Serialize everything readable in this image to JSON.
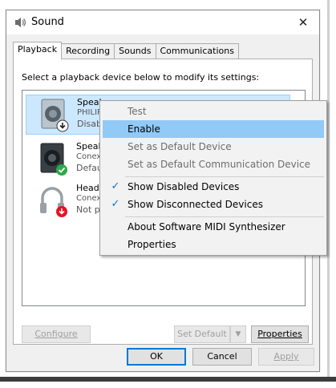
{
  "window": {
    "title": "Sound",
    "icon": "speaker-icon",
    "close_glyph": "✕"
  },
  "tabs": [
    {
      "label": "Playback",
      "active": true
    },
    {
      "label": "Recording"
    },
    {
      "label": "Sounds"
    },
    {
      "label": "Communications"
    }
  ],
  "instruction": "Select a playback device below to modify its settings:",
  "devices": [
    {
      "name": "Speakers",
      "sub": "PHILIPS",
      "status": "Disabled",
      "state_icon": "disabled-arrow-icon",
      "selected": true
    },
    {
      "name": "Speakers",
      "sub": "Conexant",
      "status": "Default",
      "state_icon": "default-check-icon"
    },
    {
      "name": "Headphones",
      "sub": "Conexant",
      "status": "Not plugged in",
      "state_icon": "unplugged-arrow-icon"
    }
  ],
  "context_menu": {
    "items": [
      {
        "label": "Test",
        "disabled": true
      },
      {
        "label": "Enable",
        "highlighted": true
      },
      {
        "label": "Set as Default Device",
        "disabled": true
      },
      {
        "label": "Set as Default Communication Device",
        "disabled": true
      },
      {
        "label": "Show Disabled Devices",
        "checked": true
      },
      {
        "label": "Show Disconnected Devices",
        "checked": true
      },
      {
        "label": "About Software MIDI Synthesizer"
      },
      {
        "label": "Properties"
      }
    ]
  },
  "buttons": {
    "configure": "Configure",
    "set_default": "Set Default",
    "properties": "Properties",
    "ok": "OK",
    "cancel": "Cancel",
    "apply": "Apply"
  },
  "colors": {
    "selection": "#cce8ff",
    "menu_highlight": "#91c9f7",
    "accent": "#0078d7",
    "check_green": "#2ea84a",
    "arrow_red": "#e81123"
  }
}
